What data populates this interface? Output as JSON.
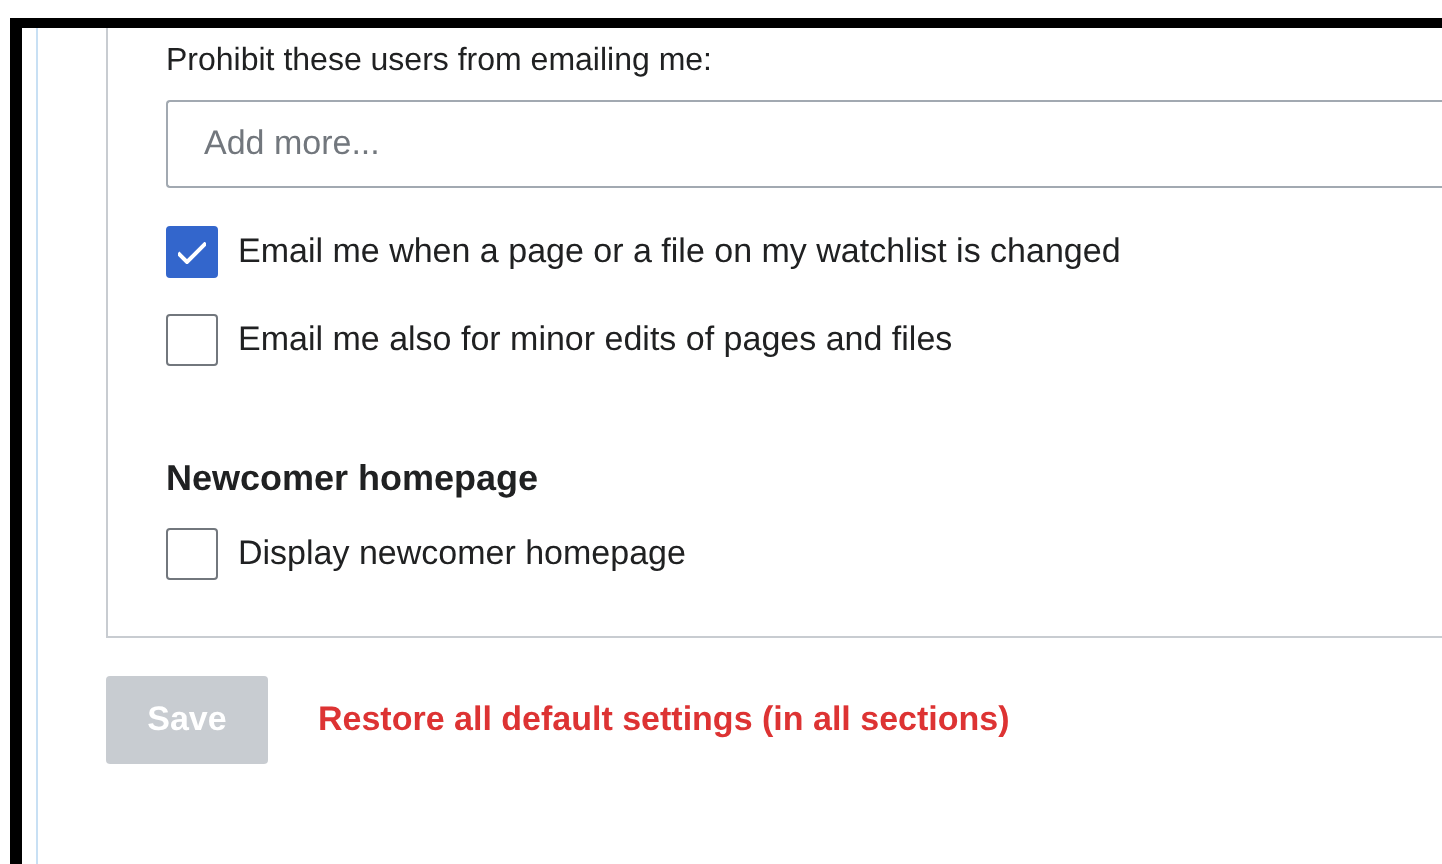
{
  "blocked_users": {
    "label": "Prohibit these users from emailing me:",
    "placeholder": "Add more..."
  },
  "email_options": [
    {
      "label": "Email me when a page or a file on my watchlist is changed",
      "checked": true
    },
    {
      "label": "Email me also for minor edits of pages and files",
      "checked": false
    }
  ],
  "newcomer": {
    "heading": "Newcomer homepage",
    "options": [
      {
        "label": "Display newcomer homepage",
        "checked": false
      }
    ]
  },
  "footer": {
    "save": {
      "label": "Save",
      "disabled": true
    },
    "restore": "Restore all default settings (in all sections)"
  }
}
